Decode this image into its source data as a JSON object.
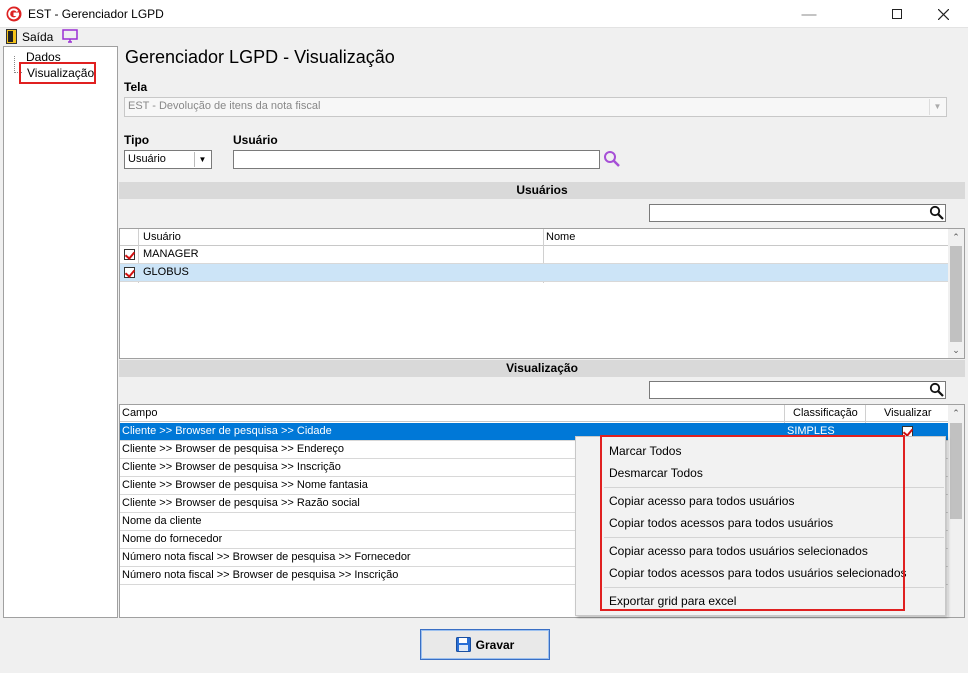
{
  "window": {
    "title": "EST - Gerenciador LGPD"
  },
  "toolbar": {
    "exit_label": "Saída"
  },
  "tree": {
    "items": [
      "Dados",
      "Visualização"
    ]
  },
  "page": {
    "title": "Gerenciador LGPD - Visualização"
  },
  "form": {
    "tela_label": "Tela",
    "tela_value": "EST - Devolução de itens da nota fiscal",
    "tipo_label": "Tipo",
    "tipo_value": "Usuário",
    "usuario_label": "Usuário",
    "usuario_value": ""
  },
  "users_section": {
    "title": "Usuários",
    "columns": [
      "Usuário",
      "Nome"
    ],
    "rows": [
      {
        "usuario": "MANAGER",
        "nome": "",
        "checked": true,
        "selected": false
      },
      {
        "usuario": "GLOBUS",
        "nome": "",
        "checked": true,
        "selected": true
      }
    ]
  },
  "vis_section": {
    "title": "Visualização",
    "columns": [
      "Campo",
      "Classificação",
      "Visualizar"
    ],
    "rows": [
      {
        "campo": "Cliente >> Browser de pesquisa >> Cidade",
        "classificacao": "SIMPLES",
        "visualizar": true,
        "selected": true
      },
      {
        "campo": "Cliente >> Browser de pesquisa >> Endereço",
        "classificacao": "",
        "visualizar": null,
        "selected": false
      },
      {
        "campo": "Cliente >> Browser de pesquisa >> Inscrição",
        "classificacao": "",
        "visualizar": null,
        "selected": false
      },
      {
        "campo": "Cliente >> Browser de pesquisa >> Nome fantasia",
        "classificacao": "",
        "visualizar": null,
        "selected": false
      },
      {
        "campo": "Cliente >> Browser de pesquisa >> Razão social",
        "classificacao": "",
        "visualizar": null,
        "selected": false
      },
      {
        "campo": "Nome da cliente",
        "classificacao": "",
        "visualizar": null,
        "selected": false
      },
      {
        "campo": "Nome do fornecedor",
        "classificacao": "",
        "visualizar": null,
        "selected": false
      },
      {
        "campo": "Número nota fiscal >> Browser de pesquisa >> Fornecedor",
        "classificacao": "",
        "visualizar": null,
        "selected": false
      },
      {
        "campo": "Número nota fiscal >> Browser de pesquisa >> Inscrição",
        "classificacao": "",
        "visualizar": null,
        "selected": false
      }
    ]
  },
  "context_menu": {
    "items": [
      "Marcar Todos",
      "Desmarcar Todos",
      "Copiar acesso para todos usuários",
      "Copiar todos acessos para todos usuários",
      "Copiar acesso para todos usuários selecionados",
      "Copiar todos acessos para todos usuários selecionados",
      "Exportar grid para excel"
    ]
  },
  "actions": {
    "save_label": "Gravar"
  },
  "colors": {
    "selection": "#0078d7",
    "selection_light": "#cce4f7",
    "highlight_border": "#e02020",
    "accent": "#3a6fc4"
  }
}
